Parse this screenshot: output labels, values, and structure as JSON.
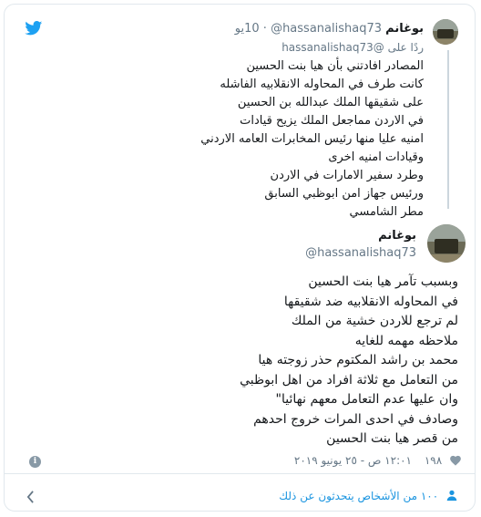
{
  "quoted": {
    "name": "بوغانم",
    "handle": "@hassanalishaq73",
    "time": "10يو",
    "reply_to": "ردًا على @hassanalishaq73",
    "lines": [
      "المصادر افادتني بأن هيا بنت الحسين",
      "كانت طرف في المحاوله الانقلابيه الفاشله",
      "على شقيقها الملك عبدالله بن الحسين",
      "في الاردن مماجعل الملك يزيح قيادات",
      "امنيه عليا منها رئيس المخابرات العامه الاردني",
      "وقيادات امنيه اخرى",
      "وطرد سفير الامارات في الاردن",
      "ورئيس جهاز امن ابوظبي السابق",
      "مطر الشامسي"
    ]
  },
  "main": {
    "name": "بوغانم",
    "handle": "@hassanalishaq73",
    "lines": [
      "وبسبب تآمر هيا بنت الحسين",
      "في المحاوله الانقلابيه ضد شقيقها",
      "لم ترجع للاردن خشية من الملك",
      "ملاحظه مهمه للغايه",
      "محمد بن راشد المكتوم حذر زوجته هيا",
      "من التعامل مع ثلاثة افراد من اهل ابوظبي",
      "وان عليها عدم التعامل معهم نهائيا\"",
      "وصادف في احدى المرات خروج احدهم",
      "من قصر هيا بنت الحسين"
    ],
    "likes": "١٩٨",
    "timestamp": "١٢:٠١ ص - ٢٥ يونيو ٢٠١٩"
  },
  "footer": {
    "people_talking": "١٠٠ من الأشخاص يتحدثون عن ذلك"
  },
  "colors": {
    "twitter_blue": "#1da1f2",
    "like_gray": "#8899a6"
  },
  "icons": {
    "logo": "twitter-bird-icon",
    "like": "heart-icon",
    "info": "info-icon",
    "chevron": "chevron-left-icon",
    "people": "user-icon"
  }
}
